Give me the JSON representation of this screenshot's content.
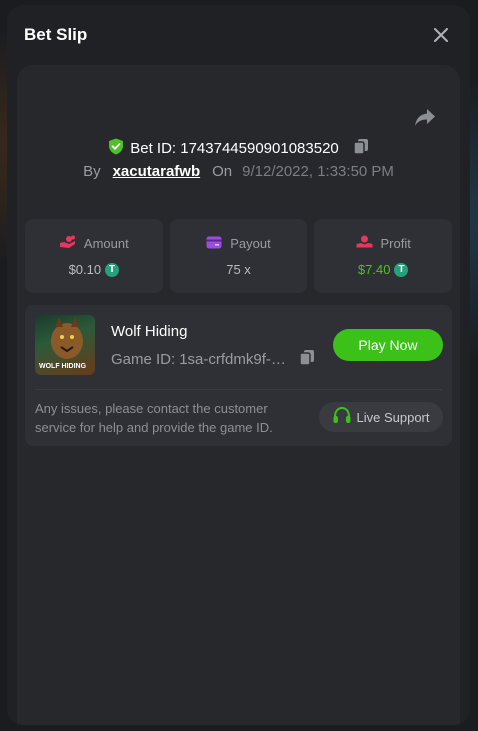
{
  "header": {
    "title": "Bet Slip"
  },
  "bet": {
    "id_label": "Bet ID: 1743744590901083520",
    "by_label": "By",
    "user": "xacutarafwb",
    "on_label": "On",
    "date": "9/12/2022, 1:33:50 PM"
  },
  "stats": {
    "amount": {
      "label": "Amount",
      "value": "$0.10",
      "coin": "T"
    },
    "payout": {
      "label": "Payout",
      "value": "75 x"
    },
    "profit": {
      "label": "Profit",
      "value": "$7.40",
      "coin": "T"
    }
  },
  "game": {
    "name": "Wolf Hiding",
    "thumb_text": "WOLF HIDING",
    "id_label": "Game ID:",
    "id_value": "1sa-crfdmk9f-1...",
    "play_label": "Play Now",
    "issue_text": "Any issues, please contact the customer service for help and provide the game ID.",
    "support_label": "Live Support"
  },
  "colors": {
    "accent_green": "#3bc117",
    "profit_green": "#4ec127",
    "shield_green": "#4ec127",
    "amount_icon": "#e8365d",
    "payout_icon": "#9b4de0",
    "profit_icon": "#e8365d"
  }
}
